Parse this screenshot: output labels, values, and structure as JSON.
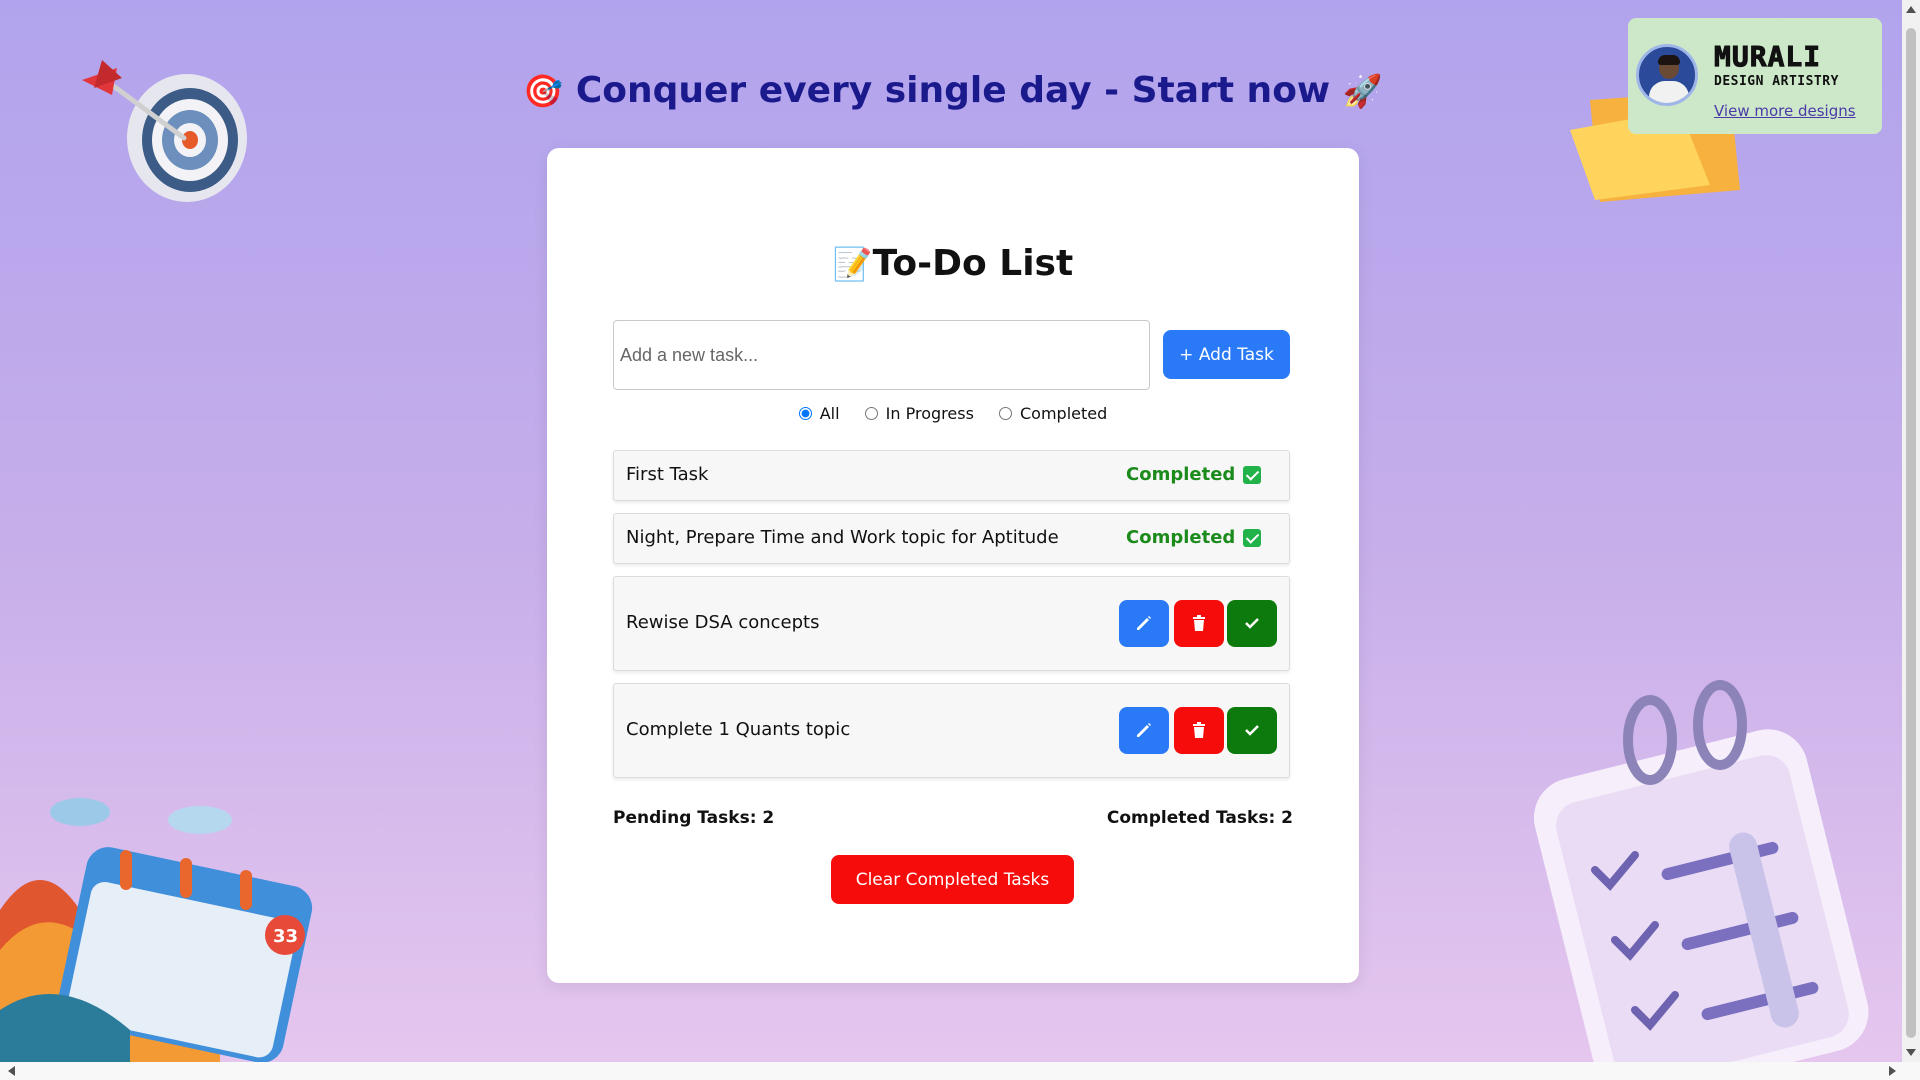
{
  "headline": {
    "emoji_left": "🎯",
    "text": "Conquer every single day - Start now",
    "emoji_right": "🚀"
  },
  "profile": {
    "brand_name": "MURALI",
    "brand_sub": "DESIGN ARTISTRY",
    "link": "View more designs"
  },
  "card": {
    "title_emoji": "📝",
    "title": "To-Do List"
  },
  "input": {
    "placeholder": "Add a new task...",
    "value": ""
  },
  "add_button": "+ Add Task",
  "filters": [
    {
      "label": "All",
      "selected": true
    },
    {
      "label": "In Progress",
      "selected": false
    },
    {
      "label": "Completed",
      "selected": false
    }
  ],
  "tasks": [
    {
      "text": "First Task",
      "status": "Completed"
    },
    {
      "text": "Night, Prepare Time and Work topic for Aptitude",
      "status": "Completed"
    },
    {
      "text": "Rewise DSA concepts",
      "status": "In Progress"
    },
    {
      "text": "Complete 1 Quants topic",
      "status": "In Progress"
    }
  ],
  "counts": {
    "pending": "Pending Tasks: 2",
    "completed": "Completed Tasks: 2"
  },
  "clear_button": "Clear Completed Tasks",
  "colors": {
    "primary": "#2a7af7",
    "danger": "#f70c0c",
    "success": "#0c7a0c",
    "completed_text": "#1b8b1b",
    "headline": "#1a1a8c"
  },
  "icons": [
    "target-icon",
    "rocket-icon",
    "memo-icon",
    "pencil-icon",
    "trash-icon",
    "check-icon",
    "checkbox-icon"
  ]
}
